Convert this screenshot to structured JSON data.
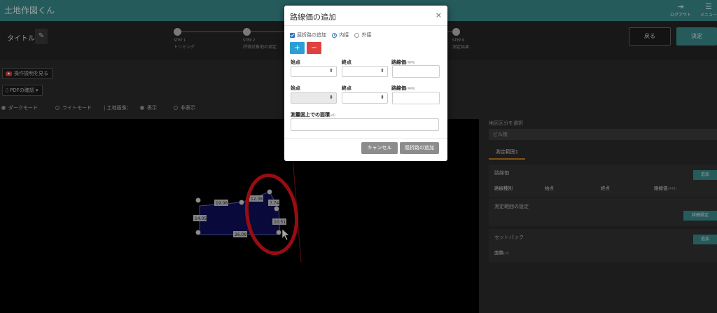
{
  "header": {
    "app_title": "土地作図くん",
    "logout_label": "ログアウト",
    "menu_label": "メニュー"
  },
  "title_bar": {
    "title_label": "タイトル：",
    "steps": [
      {
        "num": "STEP 1",
        "name": "トリミング"
      },
      {
        "num": "STEP 2",
        "name": "評価対象地の測定"
      },
      {
        "num": "STEP 6",
        "name": "測定結果"
      }
    ],
    "back_label": "戻る",
    "confirm_label": "決定"
  },
  "toolbar": {
    "manual_label": "操作説明を見る",
    "pdf_label": "PDFの確認 ▾",
    "dark_mode": "ダークモード",
    "light_mode": "ライトモード",
    "land_image_label": "土地画像：",
    "show": "表示",
    "hide": "非表示"
  },
  "canvas": {
    "labels": [
      "19.06",
      "12.38",
      "7.74",
      "14.05",
      "10.51",
      "26.09"
    ]
  },
  "right_panel": {
    "district_label": "地区区分を選択",
    "district_value": "ビル街",
    "tab_label": "測定範囲1",
    "road_section": {
      "title": "路線価",
      "add_label": "追加",
      "columns": [
        "路線種別",
        "始点",
        "終点",
        "路線価"
      ],
      "unit": "(千円)"
    },
    "range_section": {
      "title": "測定範囲の設定",
      "detail_label": "詳細設定"
    },
    "setback_section": {
      "title": "セットバック",
      "add_label": "追加",
      "area_label": "面積",
      "area_unit": "(㎡)"
    }
  },
  "modal": {
    "title": "路線価の追加",
    "close": "×",
    "bent_road_label": "屈折路の追加",
    "inner_label": "内接",
    "outer_label": "外接",
    "plus": "+",
    "minus": "−",
    "start_label": "始点",
    "end_label": "終点",
    "price_label": "路線価",
    "price_unit": "(千円)",
    "area_label": "測量図上での面積",
    "area_unit": "(㎡)",
    "cancel_label": "キャンセル",
    "add_label": "屈折路の追加"
  },
  "colors": {
    "header": "#3b8d8e",
    "accent_blue": "#2a9fd6",
    "accent_red": "#e0403e",
    "annotation_red": "#e8151b",
    "polygon_fill": "#0e0f5c"
  }
}
